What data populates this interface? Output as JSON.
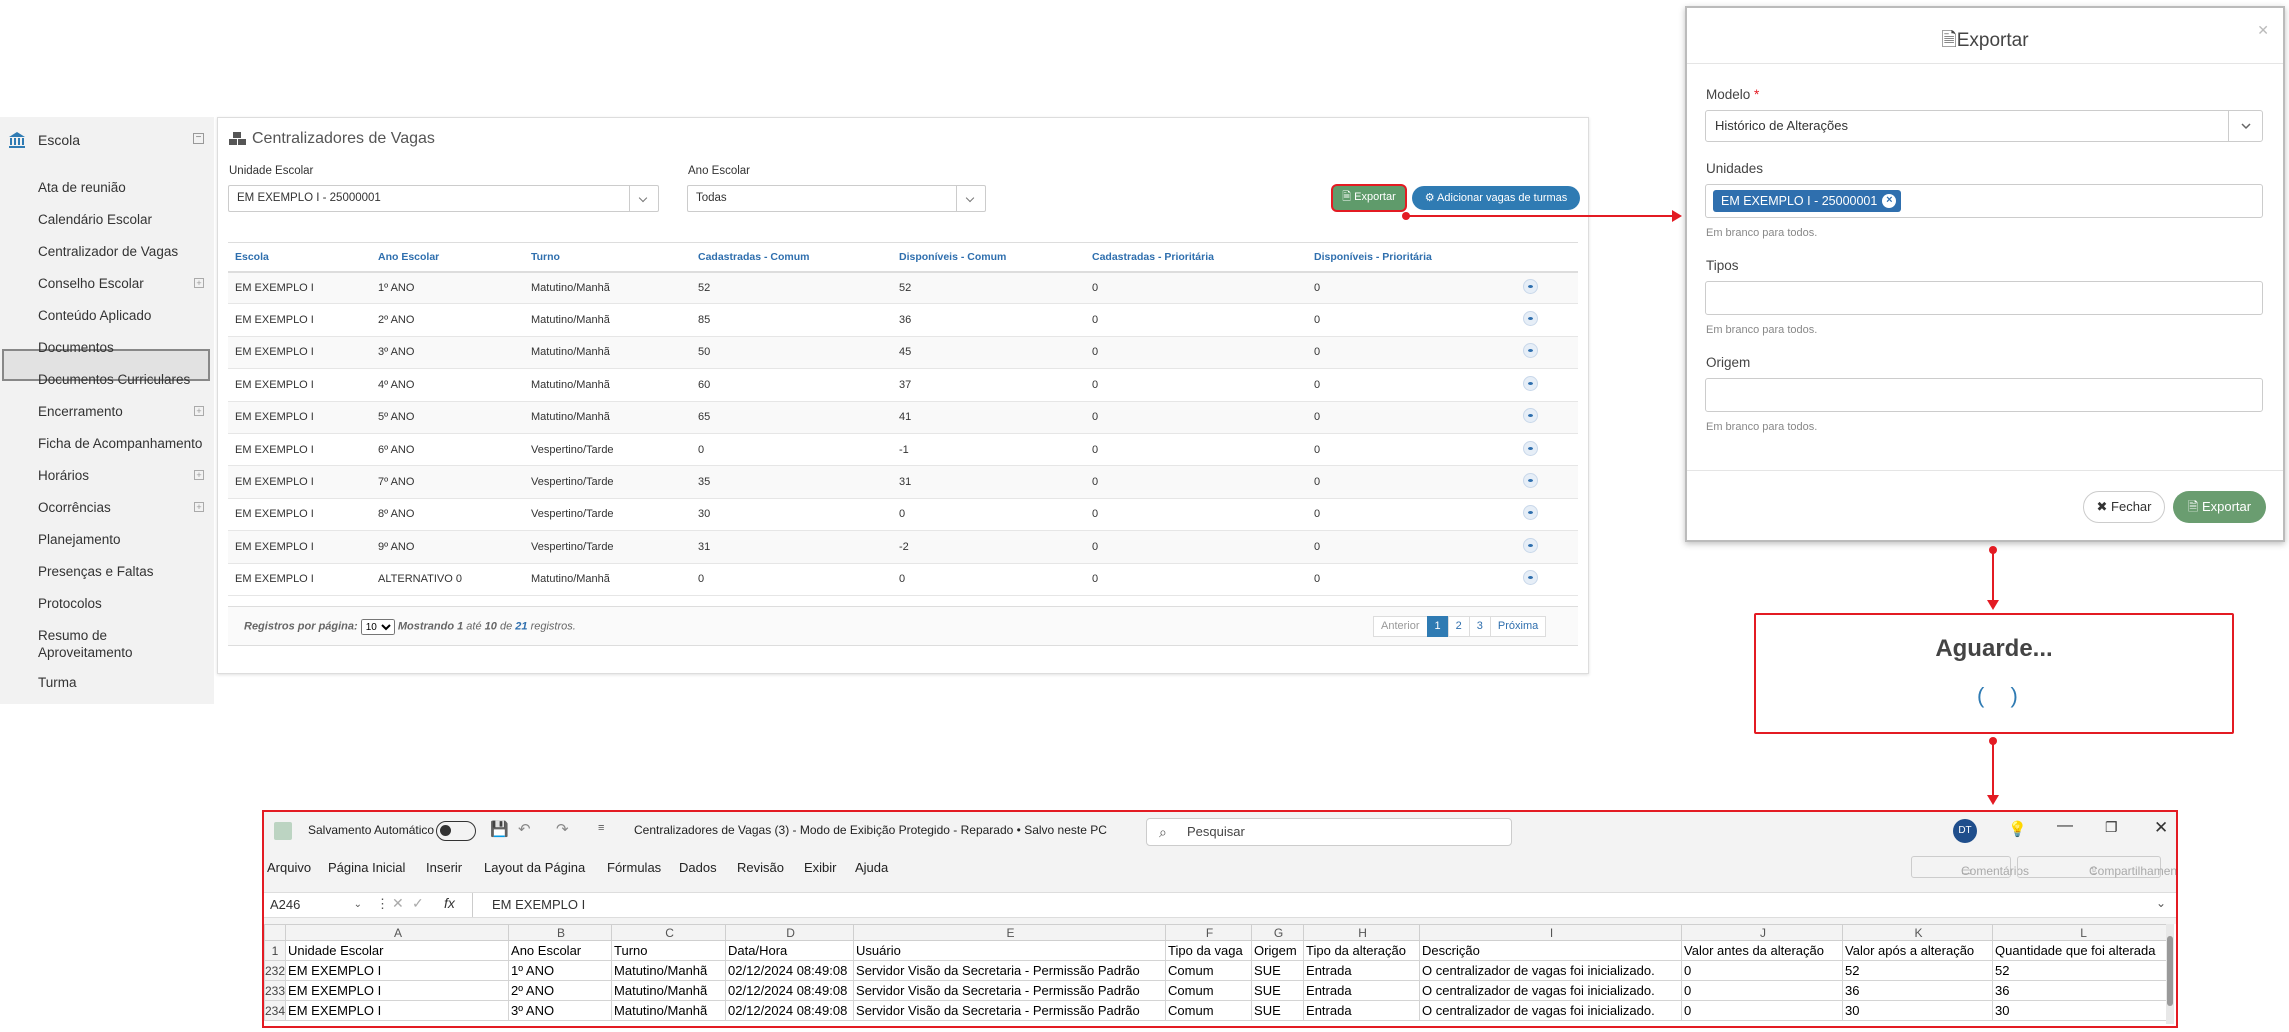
{
  "sidebar": {
    "header": "Escola",
    "items": [
      {
        "label": "Ata de reunião",
        "expandable": false
      },
      {
        "label": "Calendário Escolar",
        "expandable": false
      },
      {
        "label": "Centralizador de Vagas",
        "expandable": false,
        "active": true
      },
      {
        "label": "Conselho Escolar",
        "expandable": true
      },
      {
        "label": "Conteúdo Aplicado",
        "expandable": false
      },
      {
        "label": "Documentos",
        "expandable": false
      },
      {
        "label": "Documentos Curriculares",
        "expandable": false
      },
      {
        "label": "Encerramento",
        "expandable": true
      },
      {
        "label": "Ficha de Acompanhamento",
        "expandable": false
      },
      {
        "label": "Horários",
        "expandable": true
      },
      {
        "label": "Ocorrências",
        "expandable": true
      },
      {
        "label": "Planejamento",
        "expandable": false
      },
      {
        "label": "Presenças e Faltas",
        "expandable": false
      },
      {
        "label": "Protocolos",
        "expandable": false
      },
      {
        "label": "Resumo de Aproveitamento",
        "expandable": false
      },
      {
        "label": "Turma",
        "expandable": false
      }
    ]
  },
  "panel": {
    "title": "Centralizadores de Vagas",
    "unidade_label": "Unidade Escolar",
    "unidade_value": "EM EXEMPLO I - 25000001",
    "ano_label": "Ano Escolar",
    "ano_value": "Todas",
    "export_button": "Exportar",
    "add_button": "Adicionar vagas de turmas",
    "columns": [
      "Escola",
      "Ano Escolar",
      "Turno",
      "Cadastradas - Comum",
      "Disponíveis - Comum",
      "Cadastradas - Prioritária",
      "Disponíveis - Prioritária"
    ],
    "rows": [
      [
        "EM EXEMPLO I",
        "1º ANO",
        "Matutino/Manhã",
        "52",
        "52",
        "0",
        "0"
      ],
      [
        "EM EXEMPLO I",
        "2º ANO",
        "Matutino/Manhã",
        "85",
        "36",
        "0",
        "0"
      ],
      [
        "EM EXEMPLO I",
        "3º ANO",
        "Matutino/Manhã",
        "50",
        "45",
        "0",
        "0"
      ],
      [
        "EM EXEMPLO I",
        "4º ANO",
        "Matutino/Manhã",
        "60",
        "37",
        "0",
        "0"
      ],
      [
        "EM EXEMPLO I",
        "5º ANO",
        "Matutino/Manhã",
        "65",
        "41",
        "0",
        "0"
      ],
      [
        "EM EXEMPLO I",
        "6º ANO",
        "Vespertino/Tarde",
        "0",
        "-1",
        "0",
        "0"
      ],
      [
        "EM EXEMPLO I",
        "7º ANO",
        "Vespertino/Tarde",
        "35",
        "31",
        "0",
        "0"
      ],
      [
        "EM EXEMPLO I",
        "8º ANO",
        "Vespertino/Tarde",
        "30",
        "0",
        "0",
        "0"
      ],
      [
        "EM EXEMPLO I",
        "9º ANO",
        "Vespertino/Tarde",
        "31",
        "-2",
        "0",
        "0"
      ],
      [
        "EM EXEMPLO I",
        "ALTERNATIVO 0",
        "Matutino/Manhã",
        "0",
        "0",
        "0",
        "0"
      ]
    ],
    "footer": {
      "per_page_label": "Registros por página:",
      "per_page_value": "10",
      "showing_prefix": "Mostrando",
      "from": "1",
      "until_word": "até",
      "to": "10",
      "of_word": "de",
      "total": "21",
      "records_word": "registros."
    },
    "pager": [
      "Anterior",
      "1",
      "2",
      "3",
      "Próxima"
    ]
  },
  "modal": {
    "title": "Exportar",
    "modelo_label": "Modelo",
    "modelo_value": "Histórico de Alterações",
    "unidades_label": "Unidades",
    "unidades_tag": "EM EXEMPLO I - 25000001",
    "hint": "Em branco para todos.",
    "tipos_label": "Tipos",
    "origem_label": "Origem",
    "close_button": "Fechar",
    "export_button": "Exportar"
  },
  "wait": {
    "title": "Aguarde..."
  },
  "excel": {
    "autosave_label": "Salvamento Automático",
    "doc_title": "Centralizadores de Vagas (3)  -  Modo de Exibição Protegido  -  Reparado  •  Salvo neste PC",
    "search_placeholder": "Pesquisar",
    "user_initials": "DT",
    "menu": [
      "Arquivo",
      "Página Inicial",
      "Inserir",
      "Layout da Página",
      "Fórmulas",
      "Dados",
      "Revisão",
      "Exibir",
      "Ajuda"
    ],
    "comments_button": "Comentários",
    "share_button": "Compartilhamento",
    "cell_ref": "A246",
    "formula_value": "EM EXEMPLO I",
    "col_letters": [
      "A",
      "B",
      "C",
      "D",
      "E",
      "F",
      "G",
      "H",
      "I",
      "J",
      "K",
      "L"
    ],
    "header_row": {
      "num": "1",
      "cells": [
        "Unidade Escolar",
        "Ano Escolar",
        "Turno",
        "Data/Hora",
        "Usuário",
        "Tipo da vaga",
        "Origem",
        "Tipo da alteração",
        "Descrição",
        "Valor antes da alteração",
        "Valor após a alteração",
        "Quantidade que foi alterada"
      ]
    },
    "rows": [
      {
        "num": "232",
        "cells": [
          "EM EXEMPLO I",
          "1º ANO",
          "Matutino/Manhã",
          "02/12/2024 08:49:08",
          "Servidor Visão da Secretaria - Permissão Padrão",
          "Comum",
          "SUE",
          "Entrada",
          "O centralizador de vagas foi inicializado.",
          "0",
          "52",
          "52"
        ]
      },
      {
        "num": "233",
        "cells": [
          "EM EXEMPLO I",
          "2º ANO",
          "Matutino/Manhã",
          "02/12/2024 08:49:08",
          "Servidor Visão da Secretaria - Permissão Padrão",
          "Comum",
          "SUE",
          "Entrada",
          "O centralizador de vagas foi inicializado.",
          "0",
          "36",
          "36"
        ]
      },
      {
        "num": "234",
        "cells": [
          "EM EXEMPLO I",
          "3º ANO",
          "Matutino/Manhã",
          "02/12/2024 08:49:08",
          "Servidor Visão da Secretaria - Permissão Padrão",
          "Comum",
          "SUE",
          "Entrada",
          "O centralizador de vagas foi inicializado.",
          "0",
          "30",
          "30"
        ]
      }
    ]
  }
}
